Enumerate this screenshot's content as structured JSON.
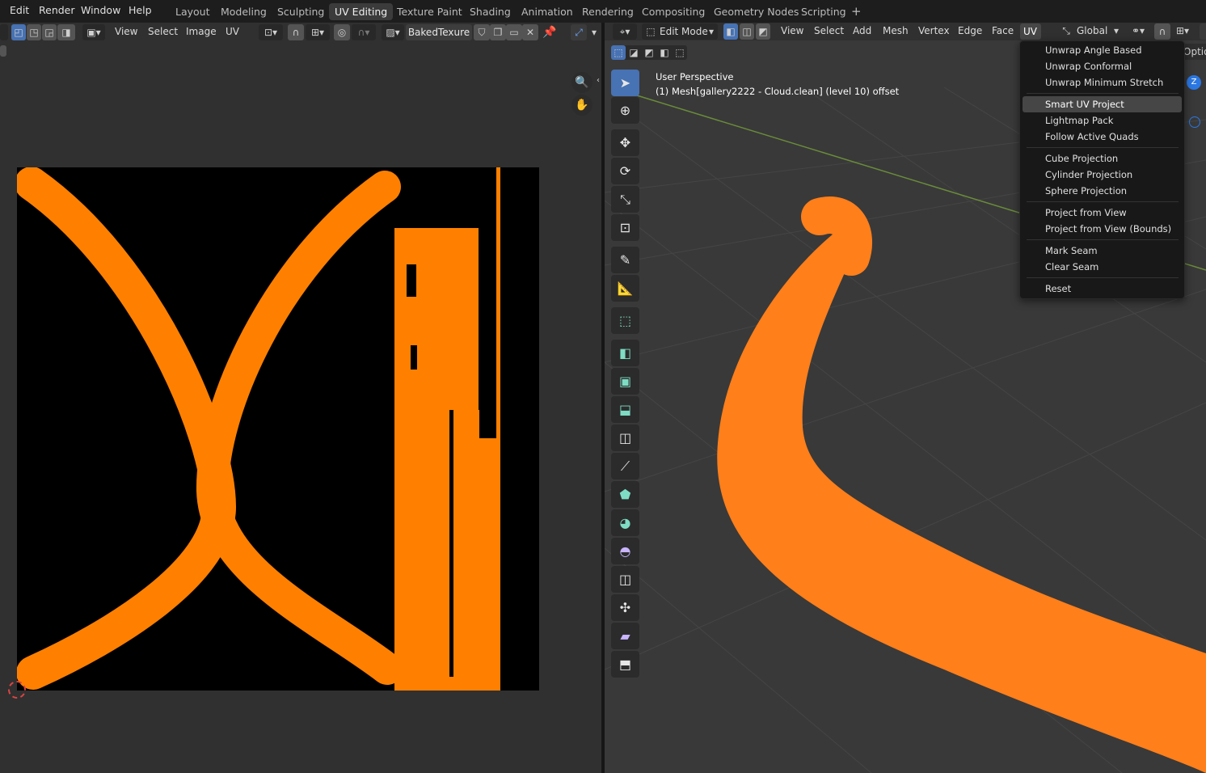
{
  "menubar": {
    "items": [
      "Edit",
      "Render",
      "Window",
      "Help"
    ]
  },
  "workspaces": {
    "tabs": [
      "Layout",
      "Modeling",
      "Sculpting",
      "UV Editing",
      "Texture Paint",
      "Shading",
      "Animation",
      "Rendering",
      "Compositing",
      "Geometry Nodes",
      "Scripting"
    ],
    "active": "UV Editing",
    "add_icon": "plus-icon"
  },
  "uv_editor": {
    "header_menus": [
      "View",
      "Select",
      "Image",
      "UV"
    ],
    "image_name": "BakedTexure",
    "canvas_background": "#000000",
    "uv_island_color": "#ff8000"
  },
  "viewport": {
    "mode": "Edit Mode",
    "header_menus": [
      "View",
      "Select",
      "Add",
      "Mesh",
      "Vertex",
      "Edge",
      "Face",
      "UV"
    ],
    "active_menu": "UV",
    "transform_orientation": "Global",
    "options_label": "Optio",
    "overlay_title": "User Perspective",
    "overlay_object": "(1) Mesh[gallery2222 - Cloud.clean] (level 10) offset",
    "gizmo_axis_label": "Z",
    "mesh_color": "#ff7f1a",
    "grid_line_x_color": "#6a8c3a"
  },
  "uv_menu": {
    "groups": [
      [
        "Unwrap Angle Based",
        "Unwrap Conformal",
        "Unwrap Minimum Stretch"
      ],
      [
        "Smart UV Project",
        "Lightmap Pack",
        "Follow Active Quads"
      ],
      [
        "Cube Projection",
        "Cylinder Projection",
        "Sphere Projection"
      ],
      [
        "Project from View",
        "Project from View (Bounds)"
      ],
      [
        "Mark Seam",
        "Clear Seam"
      ],
      [
        "Reset"
      ]
    ],
    "highlighted": "Smart UV Project"
  },
  "toolbar": {
    "tools": [
      "select-box-icon",
      "cursor-icon",
      "move-icon",
      "rotate-icon",
      "scale-icon",
      "transform-icon",
      "annotate-icon",
      "measure-icon",
      "add-cube-icon",
      "extrude-icon",
      "inset-icon",
      "bevel-icon",
      "loop-cut-icon",
      "knife-icon",
      "poly-build-icon",
      "spin-icon",
      "smooth-icon",
      "edge-slide-icon",
      "shrink-fatten-icon",
      "shear-icon",
      "rip-region-icon"
    ]
  }
}
